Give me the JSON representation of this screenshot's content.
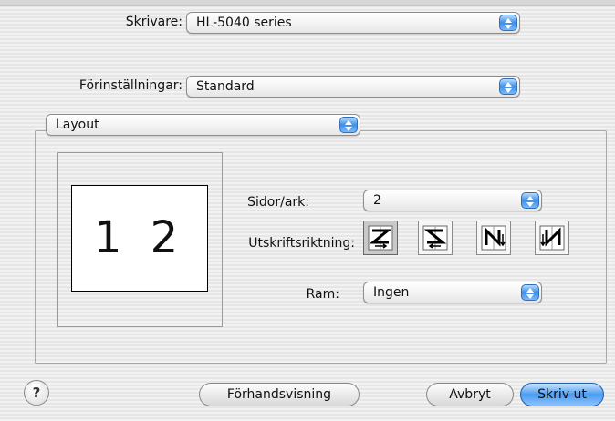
{
  "printer": {
    "label": "Skrivare:",
    "value": "HL-5040 series"
  },
  "presets": {
    "label": "Förinställningar:",
    "value": "Standard"
  },
  "panel": {
    "value": "Layout"
  },
  "layout": {
    "preview_text": "1  2",
    "pages_per_sheet": {
      "label": "Sidor/ark:",
      "value": "2"
    },
    "direction": {
      "label": "Utskriftsriktning:",
      "options": [
        {
          "icon": "z-order-icon",
          "selected": true
        },
        {
          "icon": "reverse-z-order-icon",
          "selected": false
        },
        {
          "icon": "n-order-icon",
          "selected": false
        },
        {
          "icon": "reverse-n-order-icon",
          "selected": false
        }
      ]
    },
    "border": {
      "label": "Ram:",
      "value": "Ingen"
    }
  },
  "buttons": {
    "help": "?",
    "preview": "Förhandsvisning",
    "cancel": "Avbryt",
    "print": "Skriv ut"
  },
  "colors": {
    "accent_blue": "#3d8ee6"
  }
}
